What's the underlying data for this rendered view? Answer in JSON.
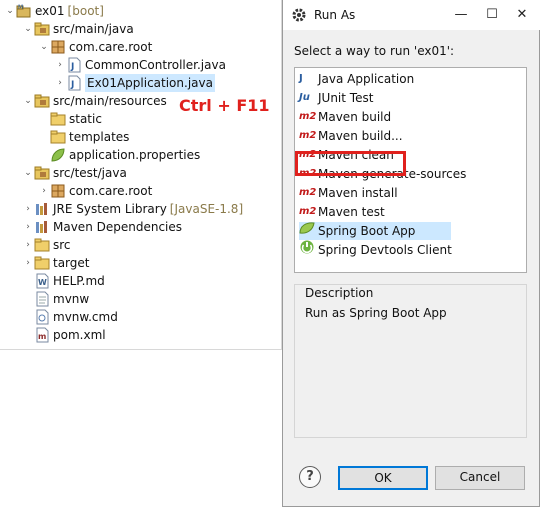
{
  "explorer": {
    "hint": "Ctrl + F11",
    "items": [
      {
        "label": "ex01",
        "decor": "[boot]"
      },
      {
        "label": "src/main/java"
      },
      {
        "label": "com.care.root"
      },
      {
        "label": "CommonController.java"
      },
      {
        "label": "Ex01Application.java"
      },
      {
        "label": "src/main/resources"
      },
      {
        "label": "static"
      },
      {
        "label": "templates"
      },
      {
        "label": "application.properties"
      },
      {
        "label": "src/test/java"
      },
      {
        "label": "com.care.root"
      },
      {
        "label": "JRE System Library",
        "decor": "[JavaSE-1.8]"
      },
      {
        "label": "Maven Dependencies"
      },
      {
        "label": "src"
      },
      {
        "label": "target"
      },
      {
        "label": "HELP.md"
      },
      {
        "label": "mvnw"
      },
      {
        "label": "mvnw.cmd"
      },
      {
        "label": "pom.xml"
      }
    ]
  },
  "dialog": {
    "title": "Run As",
    "minimize": "—",
    "maximize": "☐",
    "close": "✕",
    "select_label": "Select a way to run 'ex01':",
    "launchers": [
      {
        "label": "Java Application",
        "icon": "J"
      },
      {
        "label": "JUnit Test",
        "icon": "Ju"
      },
      {
        "label": "Maven build",
        "icon": "m2"
      },
      {
        "label": "Maven build...",
        "icon": "m2"
      },
      {
        "label": "Maven clean",
        "icon": "m2"
      },
      {
        "label": "Maven generate-sources",
        "icon": "m2"
      },
      {
        "label": "Maven install",
        "icon": "m2"
      },
      {
        "label": "Maven test",
        "icon": "m2"
      },
      {
        "label": "Spring Boot App",
        "icon": "spring-leaf-icon"
      },
      {
        "label": "Spring Devtools Client",
        "icon": "spring-devtools-icon"
      }
    ],
    "description_title": "Description",
    "description_text": "Run as Spring Boot App",
    "help": "?",
    "ok": "OK",
    "cancel": "Cancel"
  },
  "colors": {
    "highlight": "#e0211d",
    "selection": "#cce8ff",
    "ok_border": "#0078d7"
  }
}
